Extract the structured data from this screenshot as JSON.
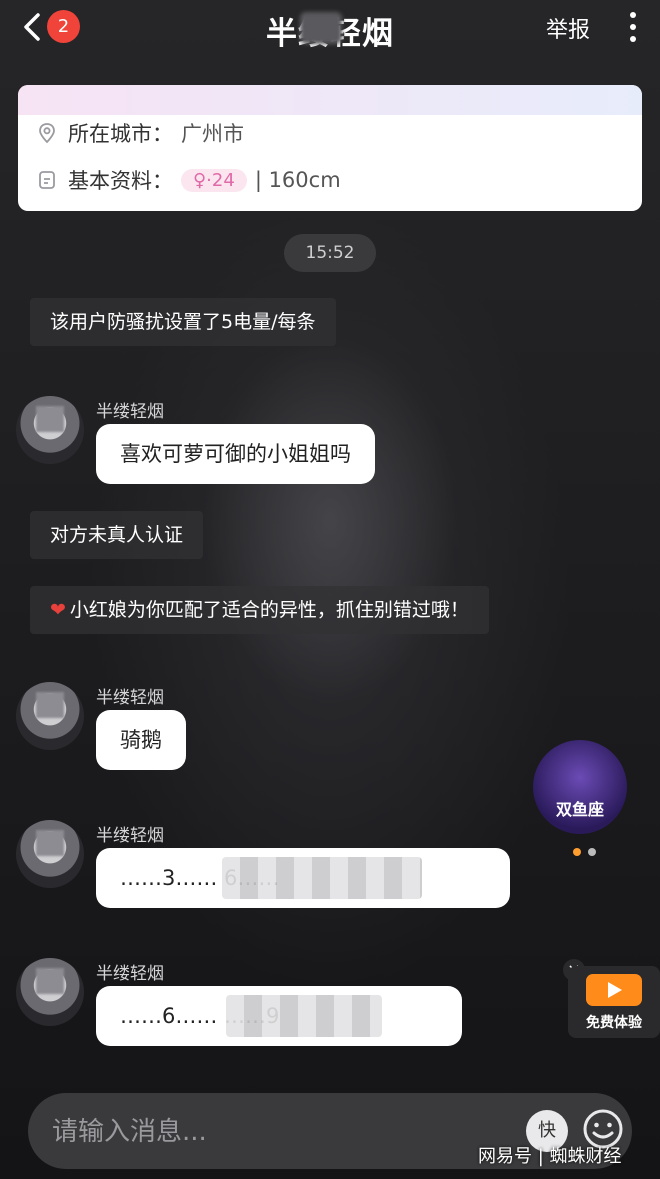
{
  "header": {
    "unread_count": "2",
    "title": "半缕轻烟",
    "report_label": "举报"
  },
  "profile_card": {
    "city_label": "所在城市：",
    "city_value": "广州市",
    "basic_label": "基本资料：",
    "age": "♀·24",
    "height": "| 160cm"
  },
  "time_divider": "15:52",
  "messages": {
    "system_1": "该用户防骚扰设置了5电量/每条",
    "sender_name": "半缕轻烟",
    "bubble_1": "喜欢可萝可御的小姐姐吗",
    "system_2": "对方未真人认证",
    "system_3": "小红娘为你匹配了适合的异性，抓住别错过哦！",
    "bubble_2": "骑鹅",
    "bubble_3": "……3……                              6……",
    "bubble_4": "……6……                         ……9"
  },
  "floating": {
    "zodiac_label": "双鱼座",
    "promo_label": "免费体验"
  },
  "input": {
    "placeholder": "请输入消息...",
    "quick_label": "快"
  },
  "watermark": "网易号 | 蜘蛛财经",
  "colors": {
    "badge": "#f0443a",
    "age_pill": "#e06aa8",
    "promo_orange": "#ff8c1a",
    "heart": "#e8403a"
  }
}
